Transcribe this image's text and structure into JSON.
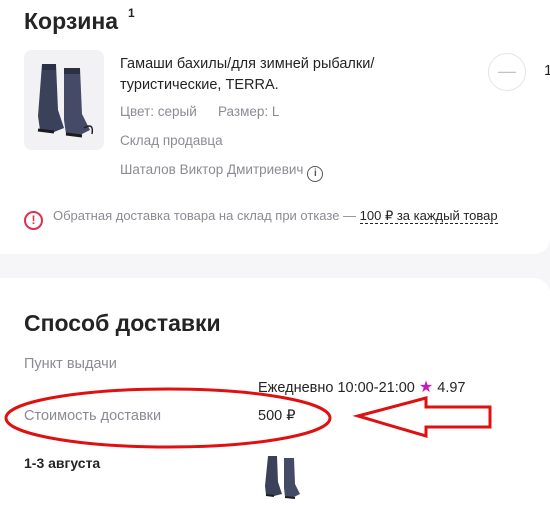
{
  "cart": {
    "title": "Корзина",
    "count": "1",
    "product": {
      "name": "Гамаши бахилы/для зимней рыбалки/туристические, TERRA.",
      "color": "Цвет: серый",
      "size": "Размер: L",
      "warehouse": "Склад продавца",
      "seller": "Шаталов Виктор Дмитриевич",
      "quantity": "1",
      "minus_label": "—"
    },
    "return_notice": {
      "text": "Обратная доставка товара на склад при отказе — ",
      "link": "100 ₽ за каждый товар"
    }
  },
  "delivery": {
    "title": "Способ доставки",
    "pickup_label": "Пункт выдачи",
    "schedule": "Ежедневно 10:00-21:00",
    "rating": "4.97",
    "cost_label": "Стоимость доставки",
    "cost_value": "500 ₽",
    "date": "1-3 августа"
  },
  "colors": {
    "annotation": "#e01010",
    "rating_star": "#c01cc0",
    "warning": "#e0304e"
  },
  "icons": {
    "info": "info-icon",
    "warning": "warning-icon",
    "star": "star-icon",
    "minus": "minus-icon"
  }
}
